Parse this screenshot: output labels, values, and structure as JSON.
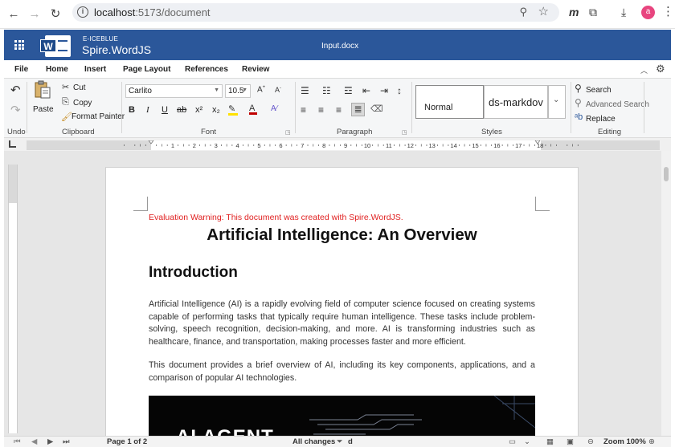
{
  "browser": {
    "url_host": "localhost",
    "url_path": ":5173/document",
    "extension_label": "m",
    "avatar_letter": "a"
  },
  "app": {
    "brand_company": "E-ICEBLUE",
    "brand_product": "Spire.WordJS",
    "document_title": "Input.docx"
  },
  "tabs": [
    "File",
    "Home",
    "Insert",
    "Page Layout",
    "References",
    "Review"
  ],
  "ribbon": {
    "undo_label": "Undo",
    "clipboard": {
      "paste": "Paste",
      "cut": "Cut",
      "copy": "Copy",
      "format_painter": "Format Painter",
      "group": "Clipboard"
    },
    "font": {
      "family": "Carlito",
      "size": "10.5",
      "group": "Font",
      "bold": "B",
      "italic": "I",
      "underline": "U",
      "strike": "ab",
      "superscript": "x²",
      "subscript": "x₂"
    },
    "paragraph_group": "Paragraph",
    "styles": {
      "normal": "Normal",
      "markdown": "ds-markdov",
      "group": "Styles"
    },
    "editing": {
      "search": "Search",
      "advanced_search": "Advanced Search",
      "replace": "Replace",
      "group": "Editing"
    }
  },
  "ruler_numbers": [
    "1",
    "2",
    "3",
    "4",
    "5",
    "6",
    "7",
    "8",
    "9",
    "10",
    "11",
    "12",
    "13",
    "14",
    "15",
    "16",
    "17",
    "18"
  ],
  "document": {
    "warning": "Evaluation Warning: This document was created with Spire.WordJS.",
    "title": "Artificial Intelligence: An Overview",
    "heading": "Introduction",
    "paragraph1": "Artificial Intelligence (AI) is a rapidly evolving field of computer science focused on creating systems capable of performing tasks that typically require human intelligence. These tasks include problem-solving, speech recognition, decision-making, and more. AI is transforming industries such as healthcare, finance, and transportation, making processes faster and more efficient.",
    "paragraph2": "This document provides a brief overview of AI, including its key components, applications, and a comparison of popular AI technologies.",
    "image_text": "AI AGENT"
  },
  "status": {
    "page": "Page 1 of 2",
    "changes": "All changes",
    "saved_suffix": "d",
    "zoom": "Zoom 100%"
  },
  "colors": {
    "appbar": "#2b579a",
    "warning": "#e02020",
    "avatar": "#e8457f"
  }
}
